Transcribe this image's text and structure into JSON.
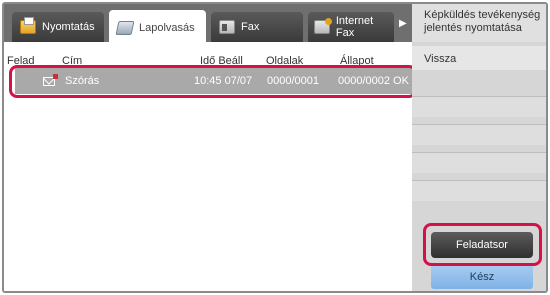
{
  "tabs": [
    {
      "label": "Nyomtatás",
      "icon": "printer-icon",
      "active": false
    },
    {
      "label": "Lapolvasás",
      "icon": "scanner-icon",
      "active": true
    },
    {
      "label": "Fax",
      "icon": "fax-icon",
      "active": false
    },
    {
      "label": "Internet Fax",
      "icon": "internet-fax-icon",
      "active": false
    }
  ],
  "tab_scroll_icon": "chevron-right-icon",
  "table": {
    "headers": [
      "Felad",
      "Cím",
      "Idő Beáll",
      "Oldalak",
      "Állapot"
    ],
    "rows": [
      {
        "icon": "email-icon",
        "title": "Szórás",
        "time": "10:45 07/07",
        "pages": "0000/0001",
        "status": "0000/0002 OK"
      }
    ]
  },
  "side": {
    "report_label": "Képküldés tevékenység jelentés nyomtatása",
    "back_label": "Vissza",
    "job_queue_label": "Feladatsor",
    "done_label": "Kész"
  },
  "colors": {
    "highlight": "#d3124a",
    "done_button": "#8fbdea",
    "selected_row": "#a9a9a9"
  }
}
